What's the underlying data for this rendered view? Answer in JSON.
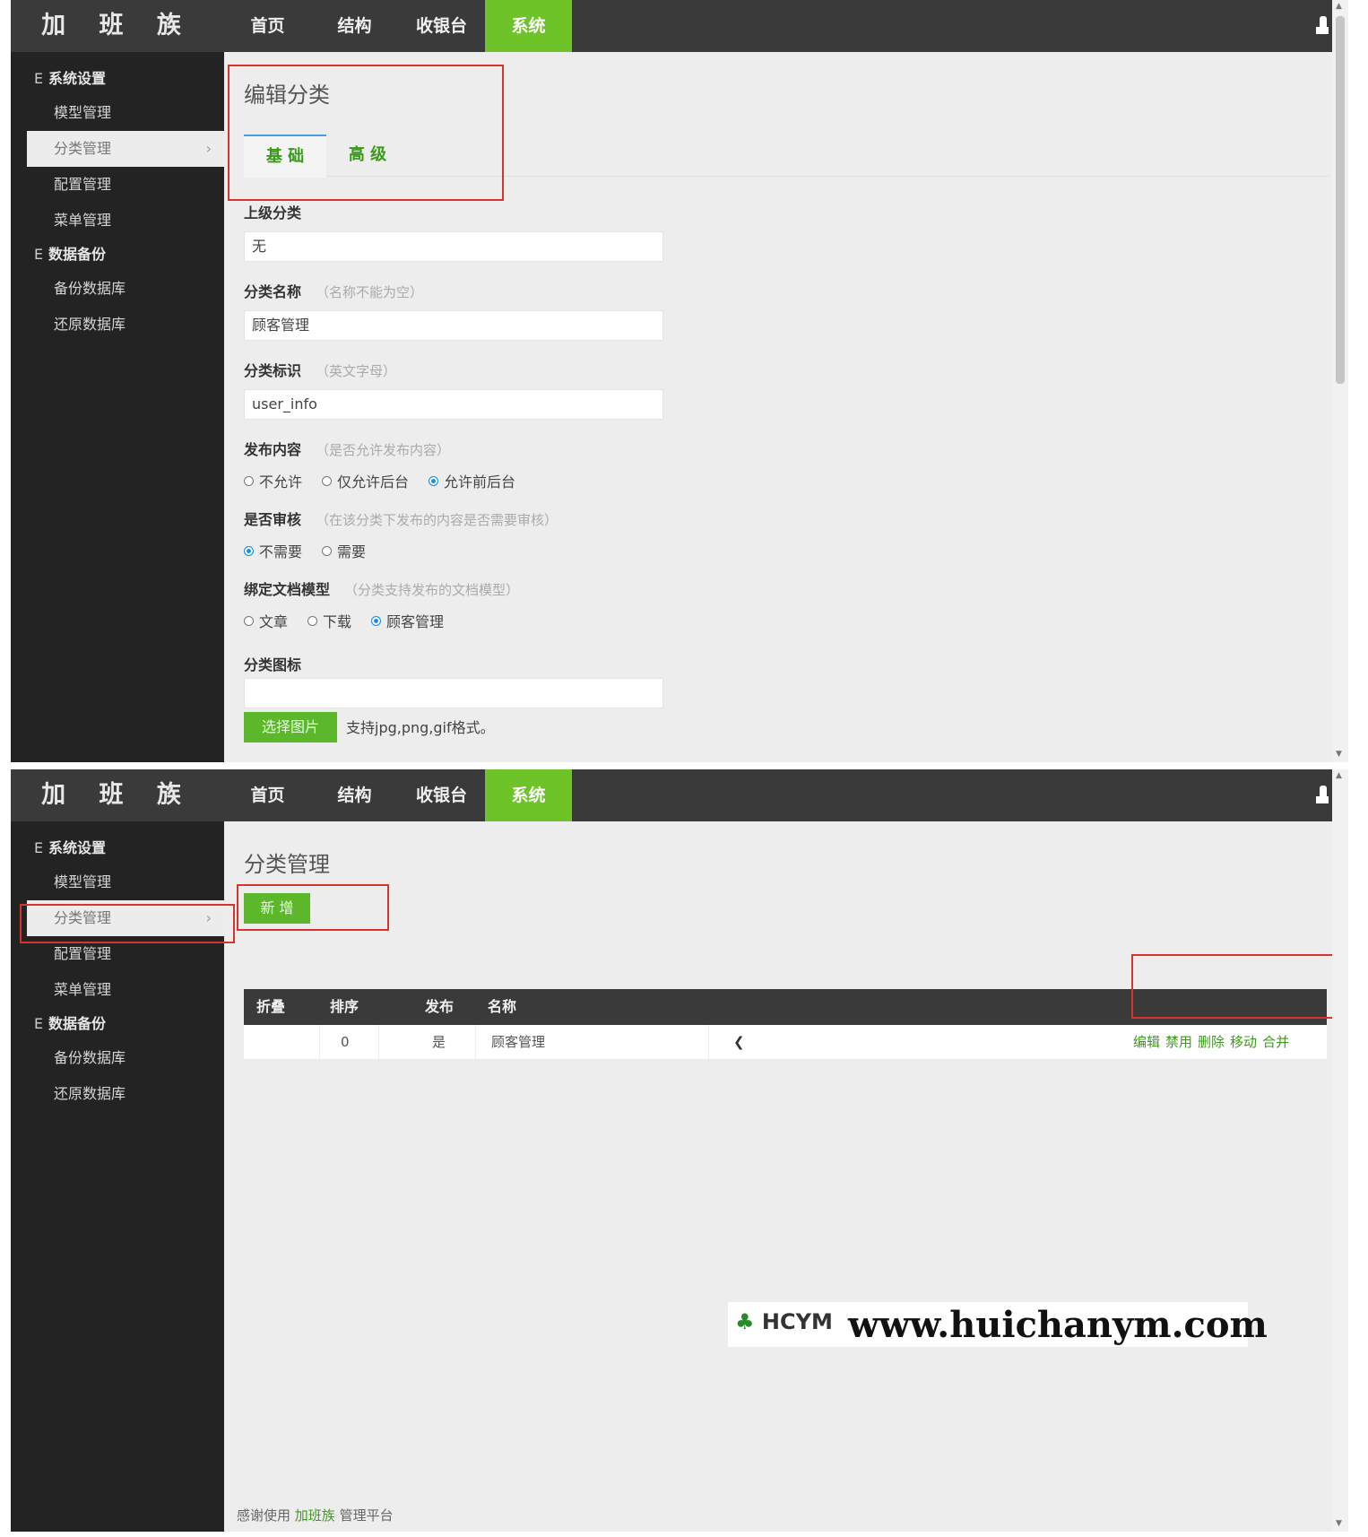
{
  "app": {
    "logo": "加 班 族",
    "nav": [
      "首页",
      "结构",
      "收银台",
      "系统"
    ],
    "active_nav": "系统"
  },
  "sidebar": {
    "group1": "系统设置",
    "group1_items": [
      "模型管理",
      "分类管理",
      "配置管理",
      "菜单管理"
    ],
    "group2": "数据备份",
    "group2_items": [
      "备份数据库",
      "还原数据库"
    ],
    "active_item": "分类管理",
    "chevron": "›"
  },
  "edit_page": {
    "title": "编辑分类",
    "tabs": [
      "基 础",
      "高 级"
    ],
    "parent": {
      "label": "上级分类",
      "value": "无"
    },
    "name": {
      "label": "分类名称",
      "hint": "（名称不能为空）",
      "value": "顾客管理"
    },
    "ident": {
      "label": "分类标识",
      "hint": "（英文字母）",
      "value": "user_info"
    },
    "publish": {
      "label": "发布内容",
      "hint": "（是否允许发布内容）",
      "options": [
        "不允许",
        "仅允许后台",
        "允许前后台"
      ],
      "selected": "允许前后台"
    },
    "audit": {
      "label": "是否审核",
      "hint": "（在该分类下发布的内容是否需要审核）",
      "options": [
        "不需要",
        "需要"
      ],
      "selected": "不需要"
    },
    "model": {
      "label": "绑定文档模型",
      "hint": "（分类支持发布的文档模型）",
      "options": [
        "文章",
        "下载",
        "顾客管理"
      ],
      "selected": "顾客管理"
    },
    "icon": {
      "label": "分类图标",
      "button": "选择图片",
      "note": "支持jpg,png,gif格式。"
    }
  },
  "list_page": {
    "title": "分类管理",
    "add_button": "新 增",
    "columns": [
      "折叠",
      "排序",
      "发布",
      "名称"
    ],
    "rows": [
      {
        "sort": "0",
        "publish": "是",
        "name": "顾客管理",
        "actions": [
          "编辑",
          "禁用",
          "删除",
          "移动",
          "合并"
        ]
      }
    ],
    "footer_prefix": "感谢使用",
    "footer_brand": "加班族",
    "footer_suffix": "管理平台"
  },
  "watermark": {
    "logo": "HCYM",
    "url": "www.huichanym.com"
  },
  "colors": {
    "accent_green": "#6dc327",
    "header": "#3a3a3a",
    "sidebar": "#232323",
    "annotation_red": "#d9332f",
    "radio_blue": "#1e8fe0"
  },
  "icons": [
    "user-icon",
    "chevron-right-icon",
    "collapse-icon"
  ]
}
